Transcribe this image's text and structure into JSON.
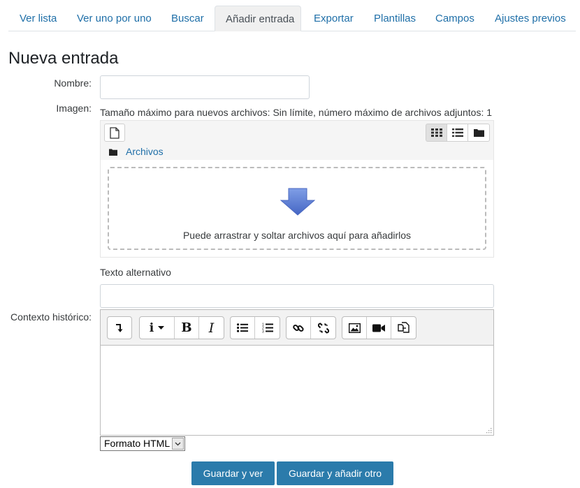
{
  "tabs": [
    {
      "label": "Ver lista"
    },
    {
      "label": "Ver uno por uno"
    },
    {
      "label": "Buscar"
    },
    {
      "label": "Añadir entrada"
    },
    {
      "label": "Exportar"
    },
    {
      "label": "Plantillas"
    },
    {
      "label": "Campos"
    },
    {
      "label": "Ajustes previos"
    }
  ],
  "active_tab": "Añadir entrada",
  "page_title": "Nueva entrada",
  "form": {
    "nombre_label": "Nombre:",
    "nombre_value": "",
    "imagen_label": "Imagen:",
    "imagen_help": "Tamaño máximo para nuevos archivos: Sin límite, número máximo de archivos adjuntos: 1",
    "folder_label": "Archivos",
    "drop_text": "Puede arrastrar y soltar archivos aquí para añadirlos",
    "alt_label": "Texto alternativo",
    "alt_value": "",
    "contexto_label": "Contexto histórico:",
    "editor_content": "",
    "format_selected": "Formato HTML"
  },
  "editor_toolbar": {
    "italic_glyph": "I",
    "bold_glyph": "B",
    "info_glyph": "i"
  },
  "buttons": {
    "save_view": "Guardar y ver",
    "save_add": "Guardar y añadir otro"
  },
  "colors": {
    "link": "#1f6fa8",
    "primary_button": "#2b7bab",
    "arrow": "#5b7fd6"
  }
}
